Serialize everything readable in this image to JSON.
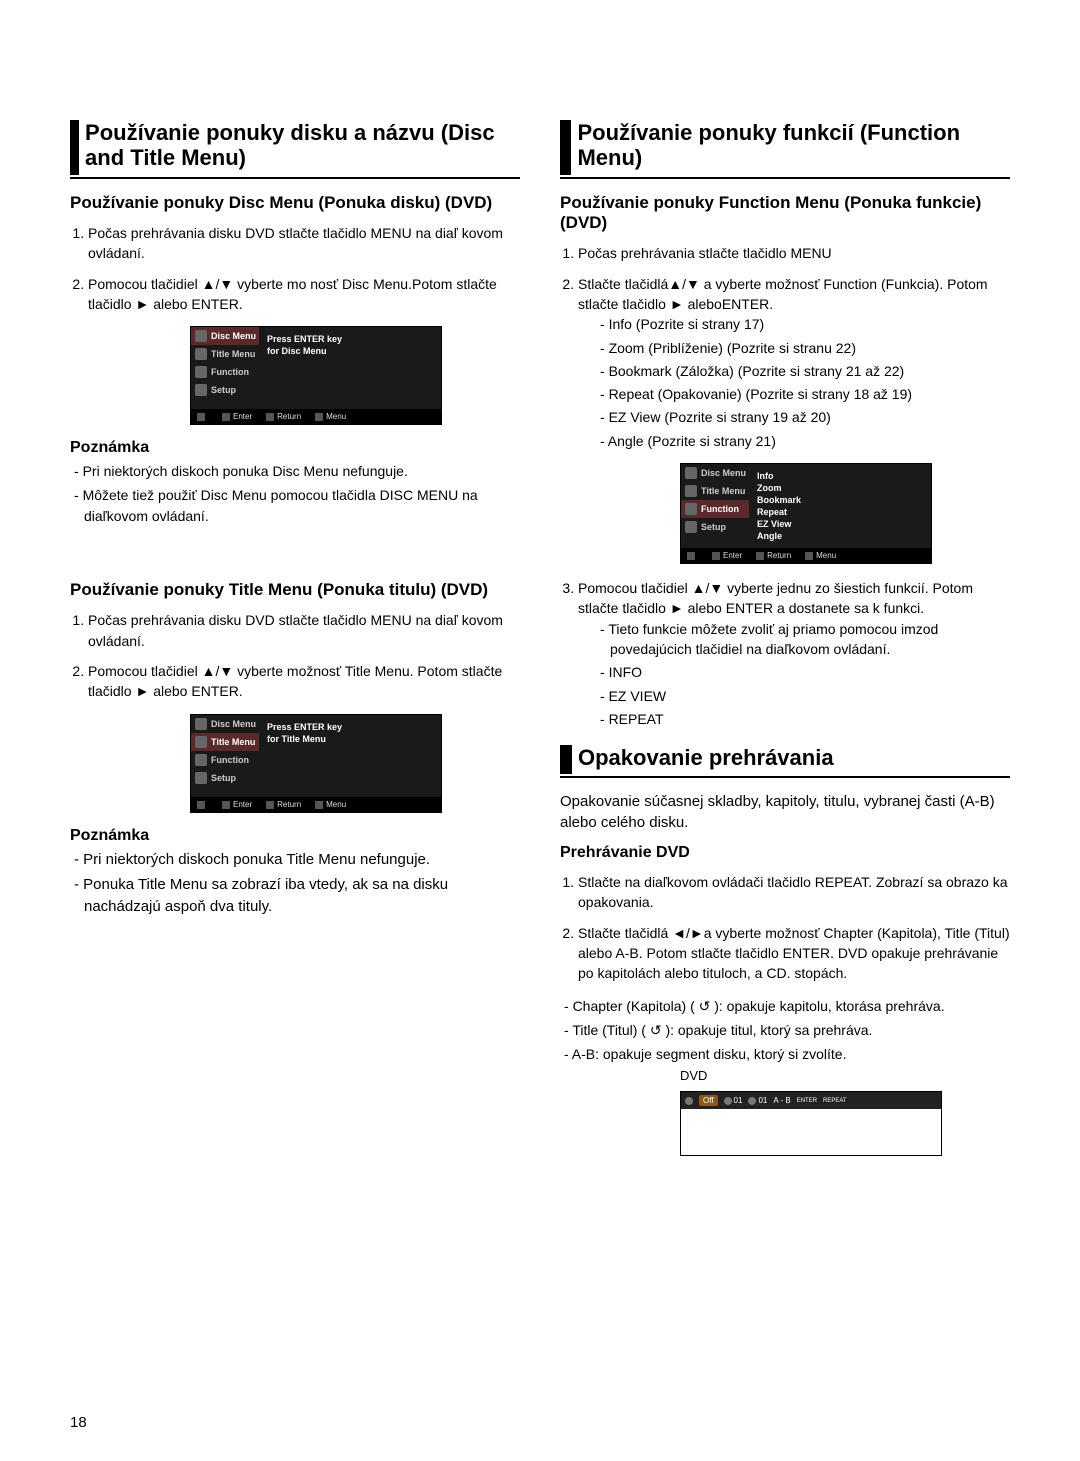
{
  "page_number": "18",
  "left": {
    "heading": "Používanie ponuky disku a názvu (Disc and Title Menu)",
    "disc_menu": {
      "title": "Používanie ponuky Disc Menu (Ponuka disku) (DVD)",
      "steps": [
        "Počas prehrávania disku DVD stlačte tlačidlo MENU na diaľ kovom ovládaní.",
        "Pomocou tlačidiel ▲/▼ vyberte mo nosť Disc Menu.Potom stlačte tlačidlo ► alebo ENTER."
      ],
      "osd": {
        "sidebar": [
          "Disc Menu",
          "Title Menu",
          "Function",
          "Setup"
        ],
        "selected": 0,
        "main_lines": [
          "Press ENTER key",
          "for Disc Menu"
        ],
        "footer": [
          "Enter",
          "Return",
          "Menu"
        ]
      },
      "note_label": "Poznámka",
      "notes": [
        "Pri niektorých diskoch ponuka Disc Menu nefunguje.",
        "Môžete tiež použiť Disc Menu pomocou tlačidla DISC MENU na diaľkovom ovládaní."
      ]
    },
    "title_menu": {
      "title": "Používanie ponuky Title Menu (Ponuka titulu) (DVD)",
      "steps": [
        "Počas prehrávania disku DVD stlačte tlačidlo MENU    na diaľ kovom ovládaní.",
        "Pomocou tlačidiel ▲/▼ vyberte možnosť Title    Menu. Potom stlačte tlačidlo ► alebo ENTER."
      ],
      "osd": {
        "sidebar": [
          "Disc Menu",
          "Title Menu",
          "Function",
          "Setup"
        ],
        "selected": 1,
        "main_lines": [
          "Press ENTER key",
          "for Title Menu"
        ],
        "footer": [
          "Enter",
          "Return",
          "Menu"
        ]
      },
      "note_label": "Poznámka",
      "notes": [
        "Pri niektorých diskoch ponuka Title Menu nefunguje.",
        "Ponuka Title Menu sa zobrazí iba vtedy, ak sa na disku nachádzajú aspoň dva tituly."
      ]
    }
  },
  "right": {
    "heading": "Používanie ponuky funkcií (Function Menu)",
    "function_menu": {
      "title": "Používanie ponuky Function Menu (Ponuka funkcie) (DVD)",
      "step1": "Počas prehrávania stlačte tlačidlo MENU",
      "step2_intro": "Stlačte tlačidlá▲/▼ a vyberte možnosť Function (Funkcia). Potom stlačte tlačidlo ► aleboENTER.",
      "step2_items": [
        "Info (Pozrite si strany 17)",
        "Zoom (Priblíženie) (Pozrite si stranu 22)",
        "Bookmark (Záložka) (Pozrite si strany 21 až 22)",
        "Repeat (Opakovanie) (Pozrite si strany 18 až 19)",
        "EZ View (Pozrite si strany 19 až 20)",
        "Angle (Pozrite si strany 21)"
      ],
      "osd": {
        "sidebar": [
          "Disc Menu",
          "Title Menu",
          "Function",
          "Setup"
        ],
        "selected": 2,
        "main_lines": [
          "Info",
          "Zoom",
          "Bookmark",
          "Repeat",
          "EZ View",
          "Angle"
        ],
        "footer": [
          "Enter",
          "Return",
          "Menu"
        ]
      },
      "step3_intro": "Pomocou tlačidiel ▲/▼ vyberte jednu zo šiestich funkcií. Potom stlačte tlačidlo ► alebo ENTER a dostanete sa k funkci.",
      "step3_note": "Tieto funkcie môžete zvoliť aj priamo pomocou imzod povedajúcich tlačidiel na diaľkovom ovládaní.",
      "step3_items": [
        "INFO",
        "EZ VIEW",
        "REPEAT"
      ]
    },
    "repeat": {
      "heading": "Opakovanie prehrávania",
      "intro": "Opakovanie súčasnej skladby, kapitoly, titulu, vybranej časti (A-B) alebo celého disku.",
      "sub_title": "Prehrávanie DVD",
      "step1": "Stlačte na diaľkovom ovládači tlačidlo REPEAT. Zobrazí sa obrazo ka opakovania.",
      "step2": "Stlačte tlačidlá ◄/►a vyberte možnosť Chapter (Kapitola), Title (Titul) alebo A-B. Potom stlačte tlačidlo ENTER. DVD opakuje prehrávanie po kapitolách alebo tituloch, a CD. stopách.",
      "bullets": [
        "Chapter (Kapitola) ( ↺ ): opakuje kapitolu, ktorása prehráva.",
        "Title (Titul) ( ↺ ): opakuje titul, ktorý sa prehráva.",
        "A-B: opakuje segment disku, ktorý si zvolíte."
      ],
      "dvd_label": "DVD",
      "repeat_bar": [
        "Off",
        "01",
        "01",
        "A - B",
        "ENTER",
        "REPEAT"
      ]
    }
  }
}
